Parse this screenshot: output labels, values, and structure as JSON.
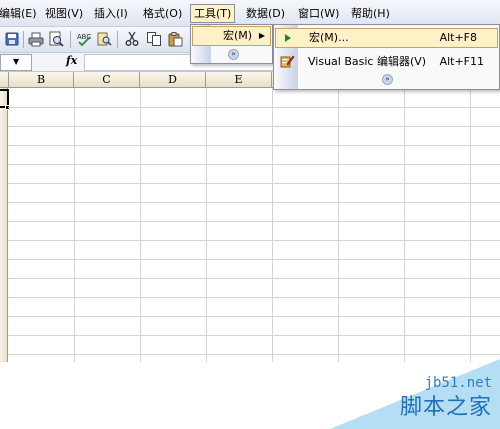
{
  "menubar": {
    "items": [
      {
        "label": "编辑(E)"
      },
      {
        "label": "视图(V)"
      },
      {
        "label": "插入(I)"
      },
      {
        "label": "格式(O)"
      },
      {
        "label": "工具(T)"
      },
      {
        "label": "数据(D)"
      },
      {
        "label": "窗口(W)"
      },
      {
        "label": "帮助(H)"
      }
    ]
  },
  "formula_bar": {
    "fx": "fx",
    "name_box_arrow": "▼"
  },
  "grid": {
    "columns": [
      "B",
      "C",
      "D",
      "E"
    ]
  },
  "tools_menu": {
    "items": [
      {
        "label": "宏(M)",
        "arrow": "▶"
      }
    ],
    "expand": "»"
  },
  "macro_submenu": {
    "items": [
      {
        "label": "宏(M)...",
        "shortcut": "Alt+F8"
      },
      {
        "label": "Visual Basic 编辑器(V)",
        "shortcut": "Alt+F11"
      }
    ],
    "expand": "»"
  },
  "watermark": {
    "site": "jb51.net",
    "name": "脚本之家"
  },
  "colors": {
    "menu_highlight": "#fff1c7",
    "menu_highlight_border": "#c2a65f",
    "grid_line": "#d4d4d4",
    "header_fill": "#e8dfc4",
    "watermark_blue": "#9bd3f0"
  }
}
